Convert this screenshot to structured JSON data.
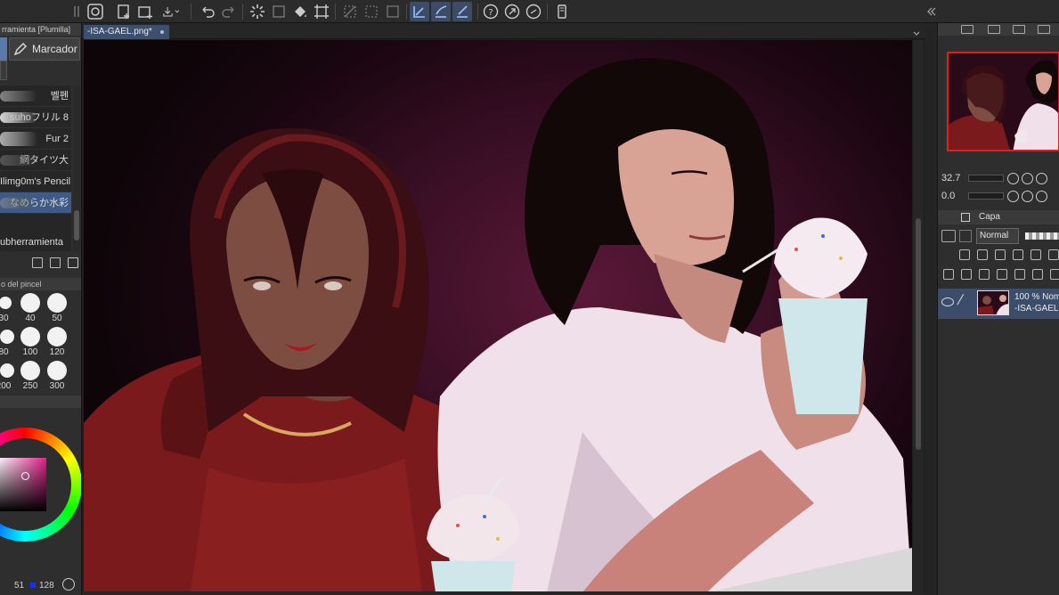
{
  "left_panel": {
    "title": "rramienta [Plumilla]",
    "tool_label": "Marcador",
    "brushes": [
      {
        "label": "벨펜"
      },
      {
        "label": "suhoフリル 8"
      },
      {
        "label": "Fur 2"
      },
      {
        "label": "網タイツ大"
      },
      {
        "label": "Ilimg0m's Pencil"
      },
      {
        "label": "なめらか水彩"
      }
    ],
    "subtool_label": "ubherramienta",
    "size_title": "o del pincel",
    "sizes": [
      "30",
      "40",
      "50",
      "80",
      "100",
      "120",
      "200",
      "250",
      "300"
    ],
    "color_readout_a": "51",
    "color_readout_b": "128"
  },
  "document": {
    "tab_label": "-ISA-GAEL.png*"
  },
  "right_panel": {
    "zoom": "32.7",
    "rotation": "0.0",
    "layer_tab": "Capa",
    "blend_mode": "Normal",
    "layer_opacity": "100 % Nom",
    "layer_name": "-ISA-GAEL"
  },
  "colors": {
    "accent": "#3d4f6e",
    "selection": "#e02020",
    "canvas_bg": "#3a0f25"
  }
}
